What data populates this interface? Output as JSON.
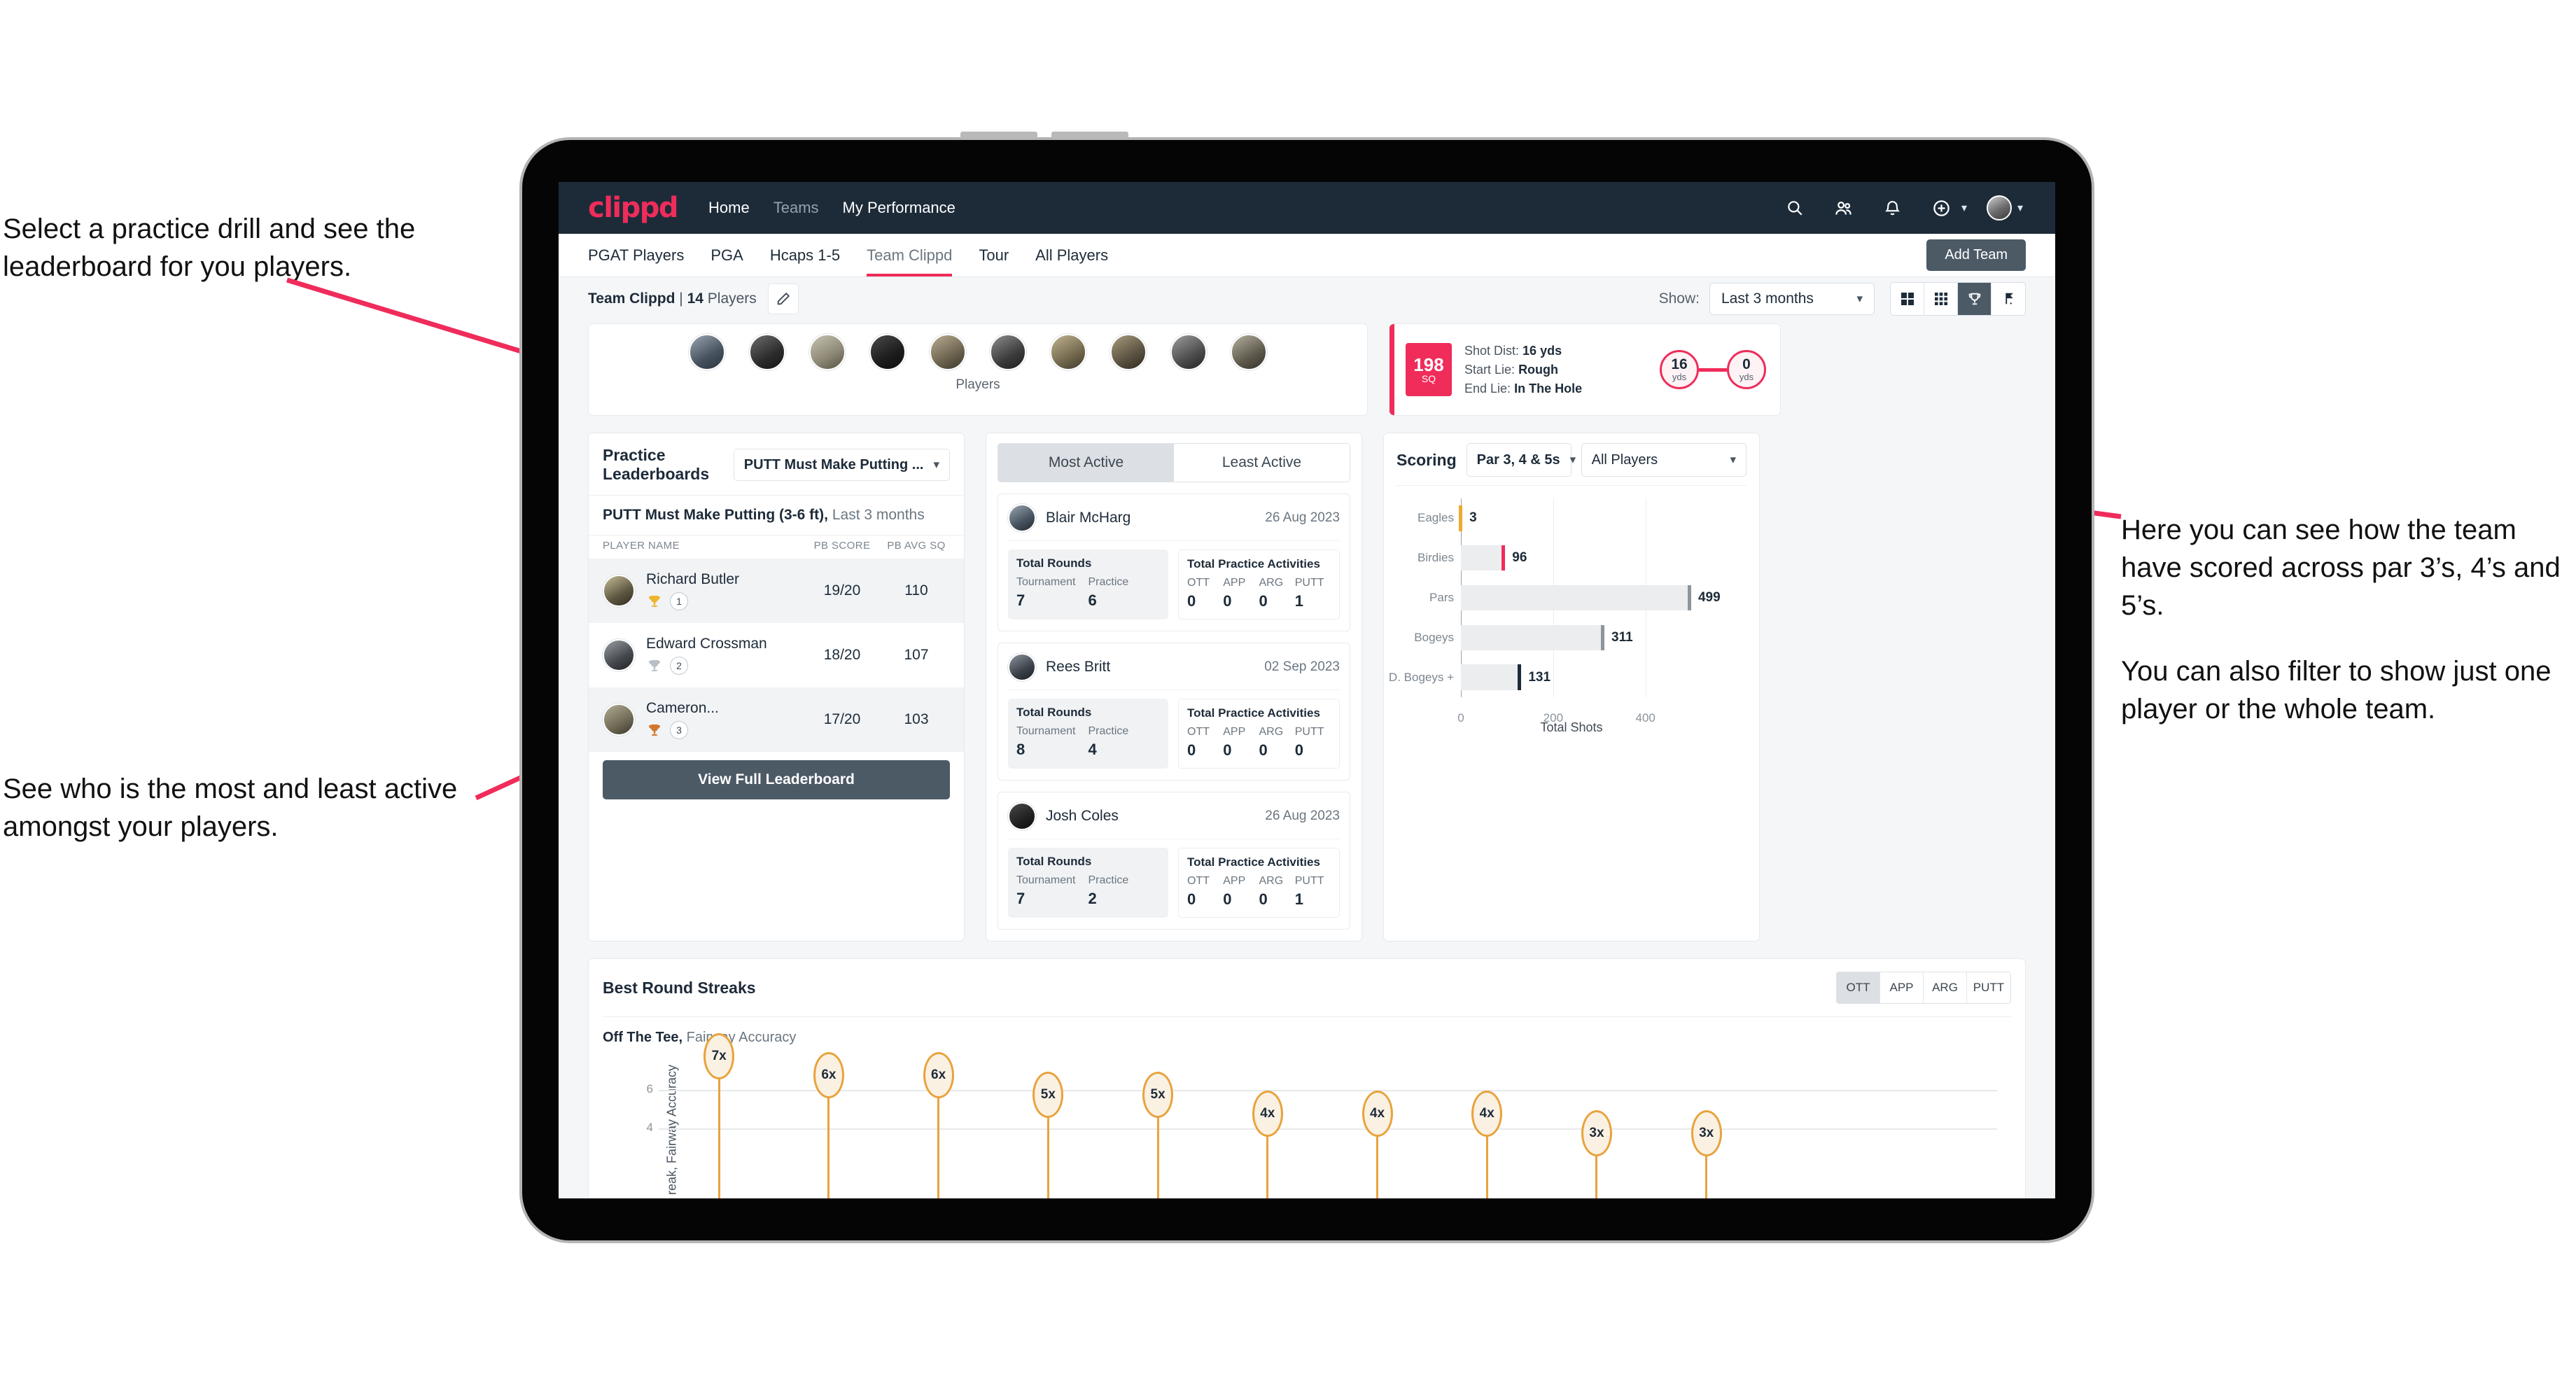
{
  "annotations": {
    "left_top": "Select a practice drill and see the leaderboard for you players.",
    "left_bottom": "See who is the most and least active amongst your players.",
    "right_1": "Here you can see how the team have scored across par 3’s, 4’s and 5’s.",
    "right_2": "You can also filter to show just one player or the whole team.",
    "arrow_color": "#ef2c5a"
  },
  "appbar": {
    "logo": "clippd",
    "links": [
      {
        "label": "Home",
        "dim": false
      },
      {
        "label": "Teams",
        "dim": true
      },
      {
        "label": "My Performance",
        "dim": false
      }
    ],
    "icons": [
      "search-icon",
      "people-icon",
      "bell-icon",
      "add-circle-icon",
      "avatar"
    ],
    "brand_color": "#ef2c5a",
    "bg_color": "#1d2b39"
  },
  "tabs": {
    "items": [
      {
        "label": "PGAT Players",
        "active": false
      },
      {
        "label": "PGA",
        "active": false
      },
      {
        "label": "Hcaps 1-5",
        "active": false
      },
      {
        "label": "Team Clippd",
        "active": true
      },
      {
        "label": "Tour",
        "active": false
      },
      {
        "label": "All Players",
        "active": false
      }
    ],
    "add_team_button": "Add Team"
  },
  "subbar": {
    "team_name": "Team Clippd",
    "separator": " | ",
    "player_count": "14",
    "players_word": " Players",
    "edit_icon": "pencil-icon",
    "show_label": "Show:",
    "show_value": "Last 3 months",
    "view_buttons": [
      {
        "name": "grid-large-view",
        "icon": "grid-4-icon",
        "active": false
      },
      {
        "name": "grid-small-view",
        "icon": "grid-9-icon",
        "active": false
      },
      {
        "name": "trophy-view",
        "icon": "trophy-icon",
        "active": true
      },
      {
        "name": "course-view",
        "icon": "flag-icon",
        "active": false
      }
    ]
  },
  "players_card": {
    "caption": "Players",
    "avatar_count": 10
  },
  "shot_card": {
    "badge_value": "198",
    "badge_unit": "SQ",
    "lines": [
      {
        "label": "Shot Dist:",
        "value": "16 yds"
      },
      {
        "label": "Start Lie:",
        "value": "Rough"
      },
      {
        "label": "End Lie:",
        "value": "In The Hole"
      }
    ],
    "start_yds": "16",
    "start_unit": "yds",
    "end_yds": "0",
    "end_unit": "yds"
  },
  "leaderboard": {
    "title": "Practice Leaderboards",
    "drill_select": "PUTT Must Make Putting ...",
    "subtitle_bold": "PUTT Must Make Putting (3-6 ft),",
    "subtitle_rest": " Last 3 months",
    "columns": [
      "PLAYER NAME",
      "PB SCORE",
      "PB AVG SQ"
    ],
    "rows": [
      {
        "name": "Richard Butler",
        "rank": "1",
        "trophy": "gold",
        "score": "19/20",
        "avg": "110"
      },
      {
        "name": "Edward Crossman",
        "rank": "2",
        "trophy": "silver",
        "score": "18/20",
        "avg": "107"
      },
      {
        "name": "Cameron...",
        "rank": "3",
        "trophy": "bronze",
        "score": "17/20",
        "avg": "103"
      }
    ],
    "button": "View Full Leaderboard"
  },
  "activity": {
    "tabs": [
      {
        "label": "Most Active",
        "active": true
      },
      {
        "label": "Least Active",
        "active": false
      }
    ],
    "rounds_title": "Total Rounds",
    "rounds_keys": [
      "Tournament",
      "Practice"
    ],
    "practice_title": "Total Practice Activities",
    "practice_keys": [
      "OTT",
      "APP",
      "ARG",
      "PUTT"
    ],
    "cards": [
      {
        "name": "Blair McHarg",
        "date": "26 Aug 2023",
        "tournament": "7",
        "practice": "6",
        "ott": "0",
        "app": "0",
        "arg": "0",
        "putt": "1"
      },
      {
        "name": "Rees Britt",
        "date": "02 Sep 2023",
        "tournament": "8",
        "practice": "4",
        "ott": "0",
        "app": "0",
        "arg": "0",
        "putt": "0"
      },
      {
        "name": "Josh Coles",
        "date": "26 Aug 2023",
        "tournament": "7",
        "practice": "2",
        "ott": "0",
        "app": "0",
        "arg": "0",
        "putt": "1"
      }
    ]
  },
  "scoring": {
    "title": "Scoring",
    "par_select": "Par 3, 4 & 5s",
    "player_select": "All Players"
  },
  "streaks": {
    "title": "Best Round Streaks",
    "tabs": [
      {
        "label": "OTT",
        "active": true
      },
      {
        "label": "APP",
        "active": false
      },
      {
        "label": "ARG",
        "active": false
      },
      {
        "label": "PUTT",
        "active": false
      }
    ],
    "sub_bold": "Off The Tee,",
    "sub_rest": " Fairway Accuracy"
  },
  "chart_data": [
    {
      "type": "bar",
      "orientation": "horizontal",
      "title": "Scoring",
      "categories": [
        "Eagles",
        "Birdies",
        "Pars",
        "Bogeys",
        "D. Bogeys +"
      ],
      "values": [
        3,
        96,
        499,
        311,
        131
      ],
      "cap_colors": [
        "#eeab2e",
        "#ef2c5a",
        "#8d959c",
        "#8d959c",
        "#1d2b39"
      ],
      "xlabel": "Total Shots",
      "ylabel": "",
      "xlim": [
        0,
        540
      ],
      "xticks": [
        0,
        200,
        400
      ],
      "grid": true,
      "legend": "none"
    },
    {
      "type": "scatter",
      "variant": "lollipop",
      "title": "Best Round Streaks",
      "subtitle": "Off The Tee, Fairway Accuracy",
      "ylabel": "Streak, Fairway Accuracy",
      "xlabel": "",
      "ylim": [
        0,
        8
      ],
      "yticks": [
        4,
        6
      ],
      "grid": true,
      "labels": [
        "7x",
        "6x",
        "6x",
        "5x",
        "5x",
        "4x",
        "4x",
        "4x",
        "3x",
        "3x"
      ],
      "values": [
        7,
        6,
        6,
        5,
        5,
        4,
        4,
        4,
        3,
        3
      ],
      "marker_color": "#e8a33d"
    }
  ]
}
